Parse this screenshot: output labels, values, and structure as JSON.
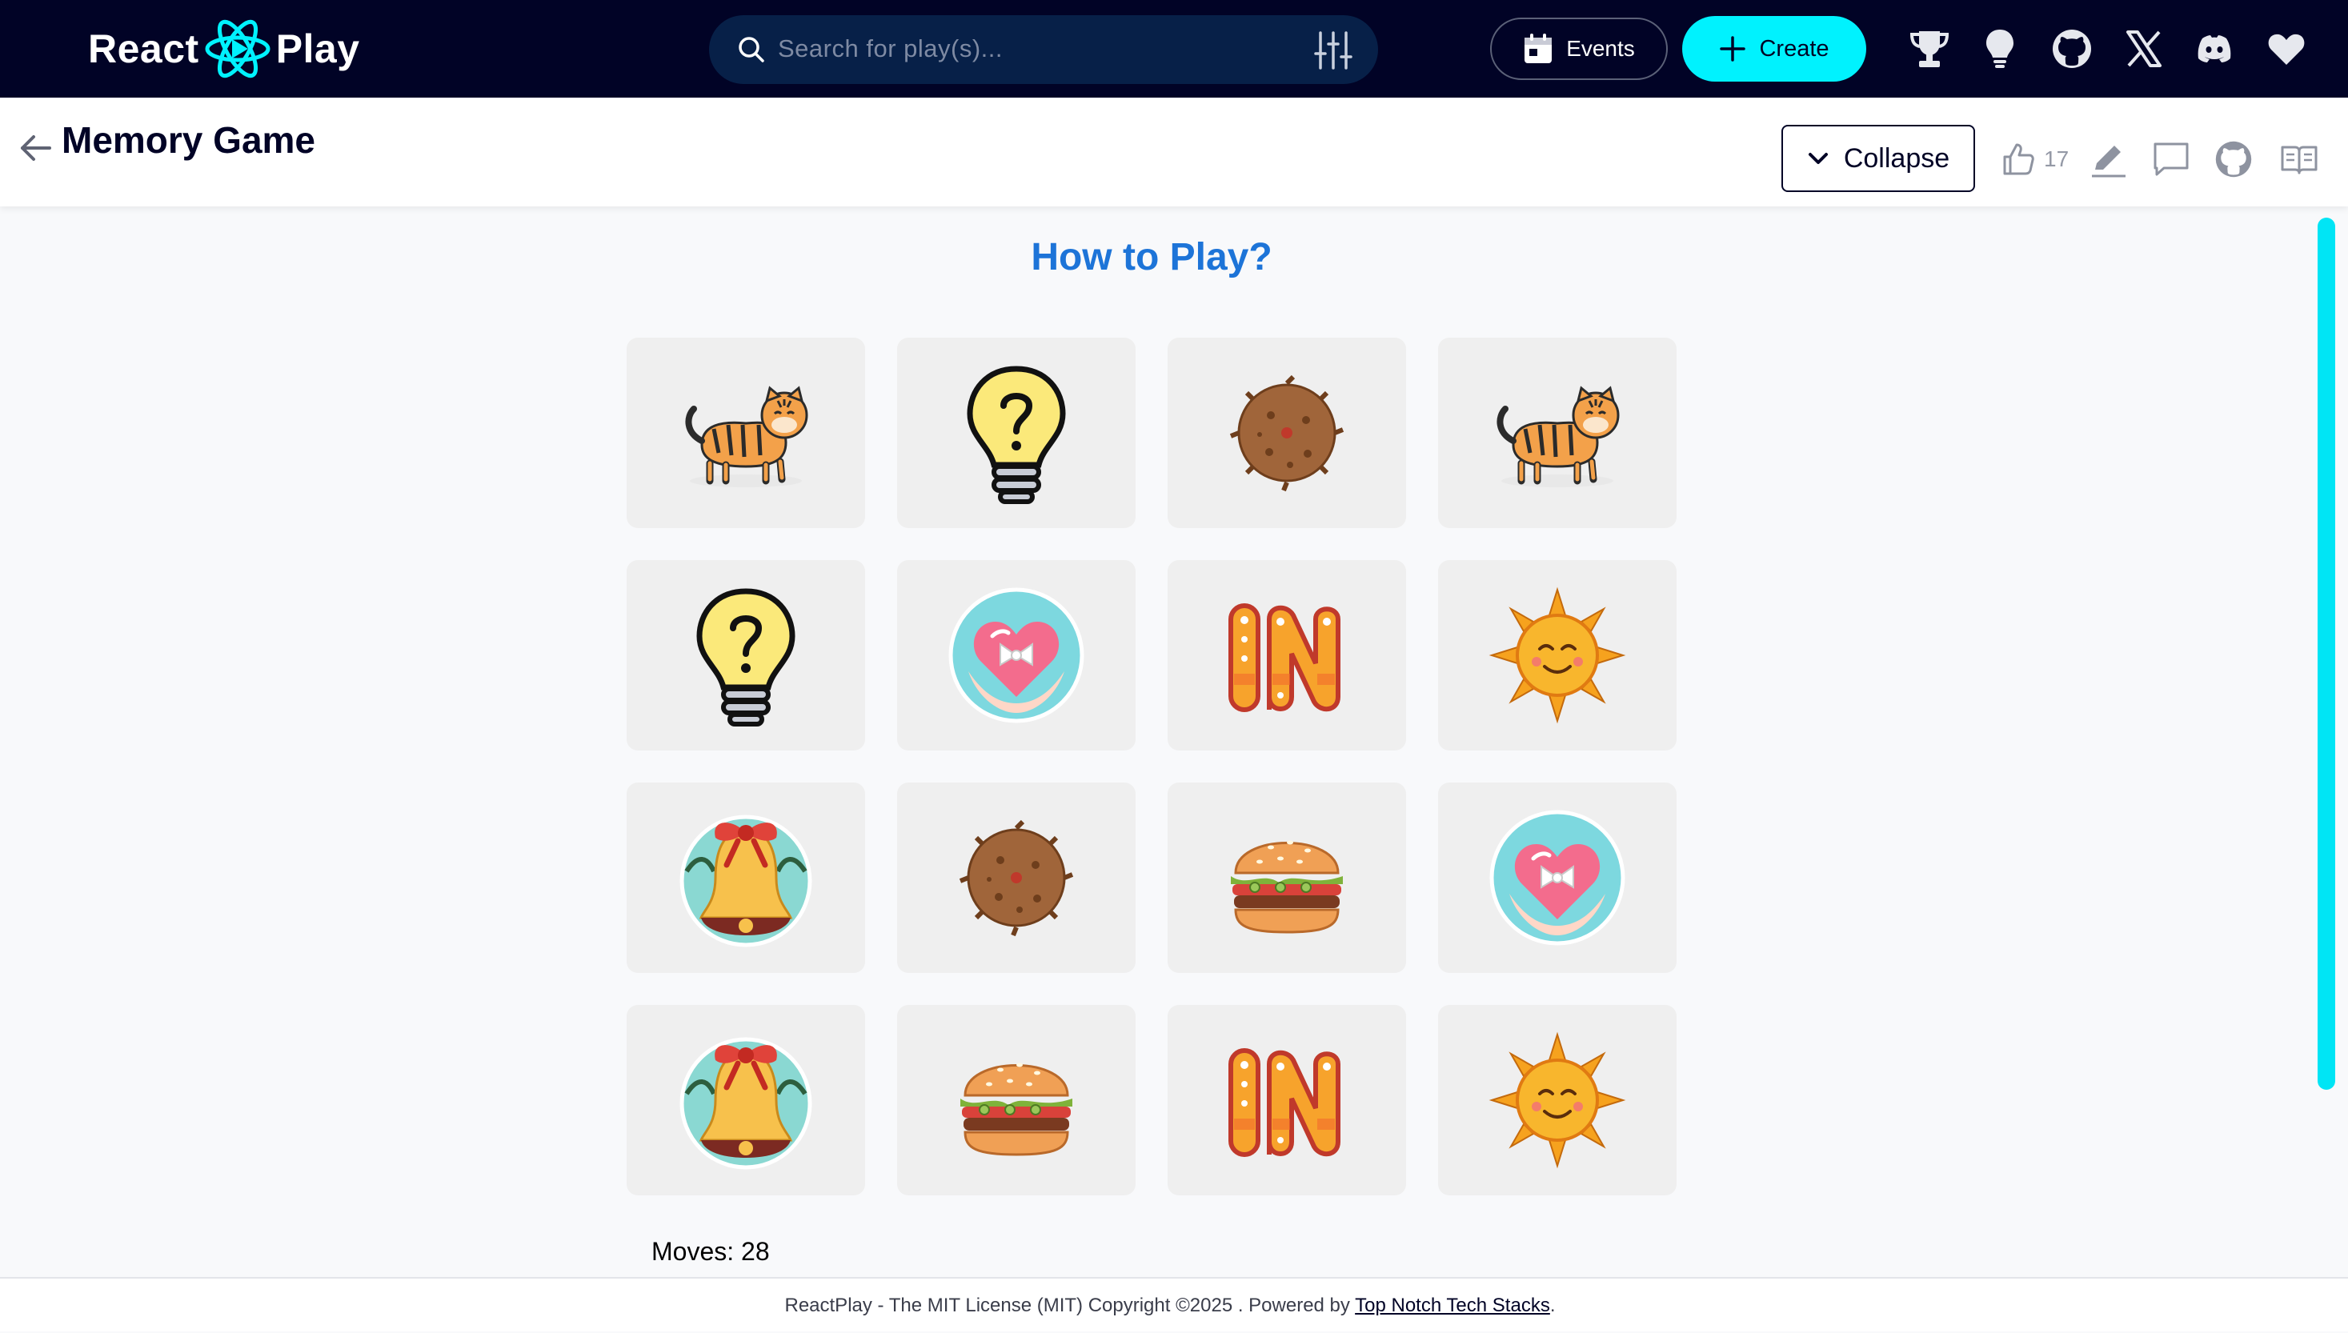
{
  "navbar": {
    "brand_left": "React",
    "brand_right": "Play",
    "search_placeholder": "Search for play(s)...",
    "events_label": "Events",
    "create_label": "Create",
    "icons": [
      "trophy-icon",
      "lightbulb-icon",
      "github-icon",
      "x-icon",
      "discord-icon",
      "heart-icon"
    ],
    "colors": {
      "background": "#010326",
      "accent": "#00f2fe",
      "search_bg": "#072048"
    }
  },
  "play_header": {
    "title": "Memory Game",
    "collapse_label": "Collapse",
    "like_count": "17",
    "icons": [
      "back-arrow-icon",
      "chevron-down-icon",
      "thumbs-up-icon",
      "edit-icon",
      "comment-icon",
      "github-icon",
      "book-icon"
    ]
  },
  "main": {
    "howto_title": "How to Play?",
    "moves_text": "Moves: 28",
    "cards": [
      "tiger",
      "question-bulb",
      "cookie",
      "tiger",
      "question-bulb",
      "heart-hands",
      "in-letters",
      "sun",
      "bell",
      "cookie",
      "burger",
      "heart-hands",
      "bell",
      "burger",
      "in-letters",
      "sun"
    ],
    "colors": {
      "title": "#1d74d8",
      "card_bg": "#efefef"
    }
  },
  "footer": {
    "text": "ReactPlay - The MIT License (MIT) Copyright ©2025 . Powered by ",
    "link_text": "Top Notch Tech Stacks",
    "suffix": "."
  }
}
